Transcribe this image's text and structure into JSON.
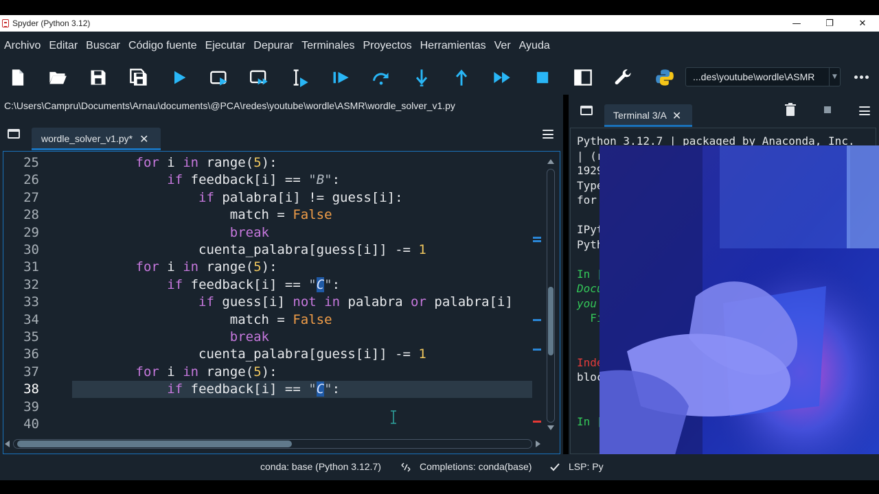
{
  "window": {
    "title": "Spyder (Python 3.12)",
    "minimize_glyph": "—",
    "maximize_glyph": "❐",
    "close_glyph": "✕"
  },
  "menu": [
    "Archivo",
    "Editar",
    "Buscar",
    "Código fuente",
    "Ejecutar",
    "Depurar",
    "Terminales",
    "Proyectos",
    "Herramientas",
    "Ver",
    "Ayuda"
  ],
  "toolbar": {
    "working_dir": "...des\\youtube\\wordle\\ASMR",
    "icons": [
      "new-file-icon",
      "open-file-icon",
      "save-icon",
      "save-all-icon",
      "run-icon",
      "run-cell-icon",
      "run-cell-advance-icon",
      "run-selection-icon",
      "debug-icon",
      "step-over-icon",
      "step-into-icon",
      "step-return-icon",
      "continue-icon",
      "stop-icon",
      "maximize-pane-icon",
      "preferences-icon",
      "python-path-icon"
    ]
  },
  "editor": {
    "file_path": "C:\\Users\\Campru\\Documents\\Arnau\\documents\\@PCA\\redes\\youtube\\wordle\\ASMR\\wordle_solver_v1.py",
    "tab_label": "wordle_solver_v1.py*",
    "tab_close": "✕",
    "active_line": 38,
    "lines": [
      {
        "n": "25",
        "code": "        for i in range(5):"
      },
      {
        "n": "26",
        "code": "            if feedback[i] == \"B\":"
      },
      {
        "n": "27",
        "code": "                if palabra[i] != guess[i]:"
      },
      {
        "n": "28",
        "code": "                    match = False"
      },
      {
        "n": "29",
        "code": "                    break"
      },
      {
        "n": "30",
        "code": "                cuenta_palabra[guess[i]] -= 1"
      },
      {
        "n": "31",
        "code": "        for i in range(5):"
      },
      {
        "n": "32",
        "code": "            if feedback[i] == \"C\":"
      },
      {
        "n": "33",
        "code": "                if guess[i] not in palabra or palabra[i]"
      },
      {
        "n": "34",
        "code": "                    match = False"
      },
      {
        "n": "35",
        "code": "                    break"
      },
      {
        "n": "36",
        "code": "                cuenta_palabra[guess[i]] -= 1"
      },
      {
        "n": "37",
        "code": "        for i in range(5):"
      },
      {
        "n": "38",
        "code": "            if feedback[i] == \"C\":"
      },
      {
        "n": "39",
        "code": ""
      },
      {
        "n": "40",
        "code": ""
      }
    ]
  },
  "terminal": {
    "tab_label": "Terminal 3/A",
    "tab_close": "✕",
    "lines": [
      {
        "text": "Python 3.12.7 | packaged by Anaconda, Inc.",
        "style": "plain"
      },
      {
        "text": "| (r",
        "style": "plain"
      },
      {
        "text": "1929",
        "style": "plain"
      },
      {
        "text": "Type",
        "style": "plain"
      },
      {
        "text": "for",
        "style": "plain"
      },
      {
        "text": "",
        "style": "plain"
      },
      {
        "text": "IPyt",
        "style": "plain"
      },
      {
        "text": "Pyth",
        "style": "plain"
      },
      {
        "text": "",
        "style": "plain"
      },
      {
        "text": "In [",
        "style": "green"
      },
      {
        "text": "Docu",
        "style": "ital"
      },
      {
        "text": "you",
        "style": "ital"
      },
      {
        "text": "  Fi",
        "style": "green"
      },
      {
        "text": "",
        "style": "plain"
      },
      {
        "text": "",
        "style": "plain"
      },
      {
        "text": "Inde",
        "style": "red"
      },
      {
        "text": "bloc",
        "style": "plain"
      },
      {
        "text": "",
        "style": "plain"
      },
      {
        "text": "",
        "style": "plain"
      },
      {
        "text": "In [",
        "style": "green"
      }
    ]
  },
  "status": {
    "env": "conda: base (Python 3.12.7)",
    "completions": "Completions: conda(base)",
    "lsp": "LSP: Py"
  },
  "colors": {
    "background": "#19232d",
    "accent": "#1a72bb",
    "keyword": "#c678dd",
    "number": "#f0c75e",
    "constant": "#f29e48"
  }
}
